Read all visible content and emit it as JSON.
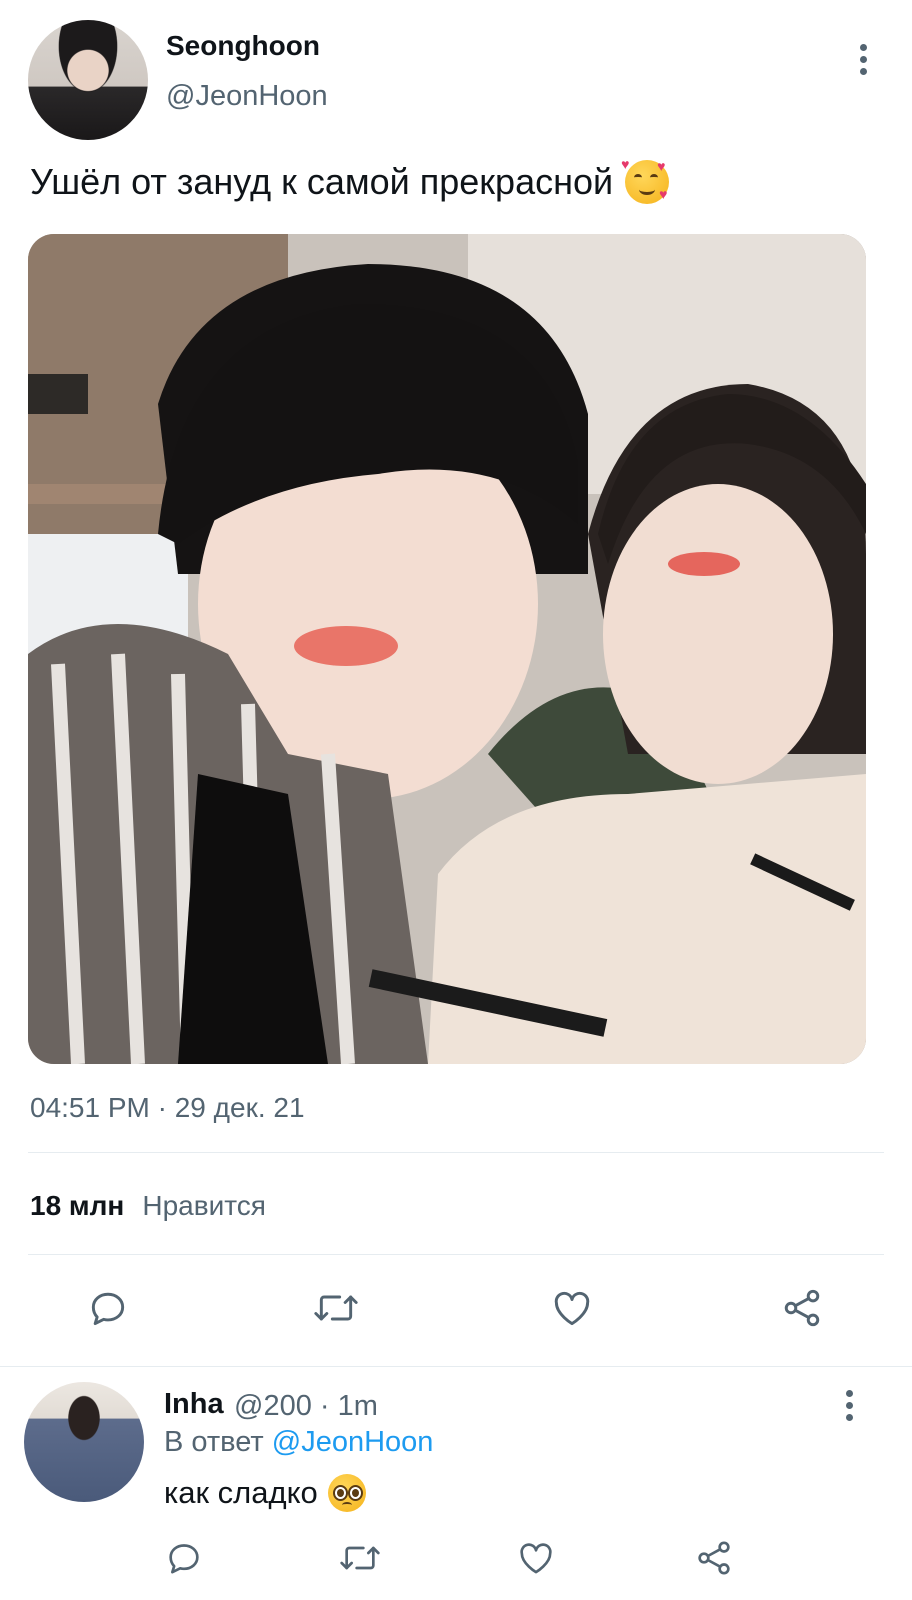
{
  "tweet": {
    "display_name": "Seonghoon",
    "handle": "@JeonHoon",
    "text": "Ушёл от зануд к самой прекрасной",
    "timestamp": "04:51 PM · 29 дек. 21",
    "likes_count": "18 млн",
    "likes_label": "Нравится"
  },
  "reply": {
    "display_name": "Inha",
    "handle_time": "@200 · 1m",
    "in_reply_prefix": "В ответ ",
    "in_reply_mention": "@JeonHoon",
    "text": "как сладко"
  },
  "icons": {
    "more": "more-vertical-icon",
    "reply": "reply-icon",
    "retweet": "retweet-icon",
    "like": "heart-icon",
    "share": "share-icon"
  },
  "colors": {
    "text_primary": "#0f1419",
    "text_secondary": "#536471",
    "link": "#1d9bf0",
    "divider": "#e6ecf0"
  }
}
